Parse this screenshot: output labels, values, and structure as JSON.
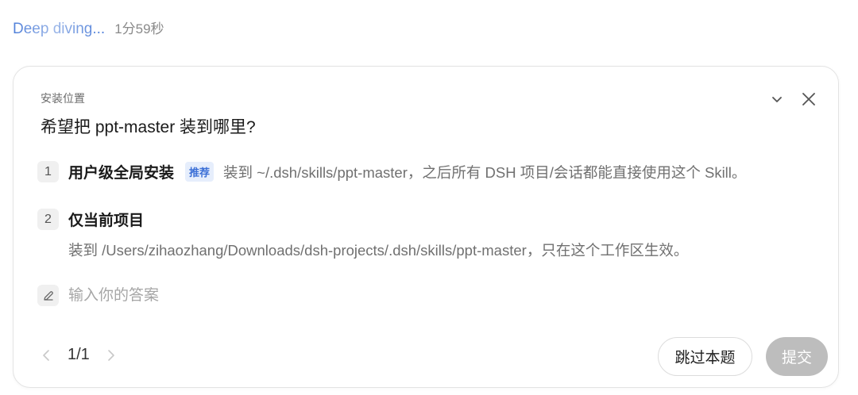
{
  "status": {
    "label": "Deep diving...",
    "elapsed": "1分59秒"
  },
  "card": {
    "section_label": "安装位置",
    "question": "希望把 ppt-master 装到哪里?",
    "options": [
      {
        "number": "1",
        "title": "用户级全局安装",
        "badge": "推荐",
        "description": "装到 ~/.dsh/skills/ppt-master，之后所有 DSH 项目/会话都能直接使用这个 Skill。"
      },
      {
        "number": "2",
        "title": "仅当前项目",
        "description": "装到 /Users/zihaozhang/Downloads/dsh-projects/.dsh/skills/ppt-master，只在这个工作区生效。"
      }
    ],
    "answer_placeholder": "输入你的答案",
    "pager": "1/1",
    "skip_label": "跳过本题",
    "submit_label": "提交"
  },
  "icons": {
    "collapse": "chevron-down-icon",
    "close": "close-icon",
    "answer": "pencil-icon",
    "prev": "chevron-left-icon",
    "next": "chevron-right-icon"
  },
  "colors": {
    "accent": "#4f7fd9",
    "badge_bg": "#e6eefc",
    "badge_text": "#3b6fd6",
    "submit_disabled": "#bdbdbd"
  }
}
